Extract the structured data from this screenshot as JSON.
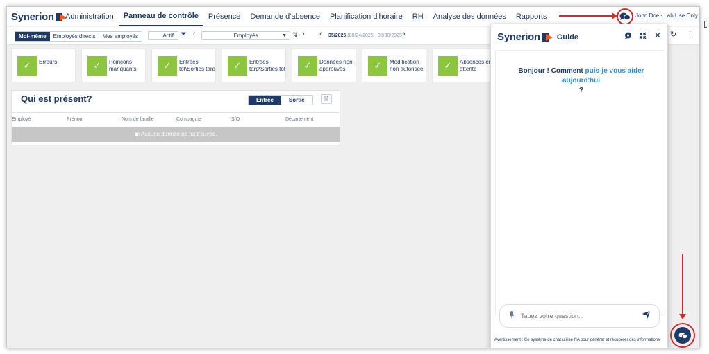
{
  "app": {
    "brand": "Synerion"
  },
  "nav": {
    "items": [
      "Administration",
      "Panneau de contrôle",
      "Présence",
      "Demande d'absence",
      "Planification d'horaire",
      "RH",
      "Analyse des données",
      "Rapports"
    ],
    "active": "Panneau de contrôle"
  },
  "user": {
    "name": "John Doe - Lab Use Only"
  },
  "toolbar": {
    "scope": [
      "Moi-même",
      "Employés directs",
      "Mes employés"
    ],
    "scope_active": "Moi-même",
    "status": "Actif",
    "group": "Employés",
    "period_week": "35/2025",
    "period_range": "(08/24/2025 - 08/30/2025)"
  },
  "cards": [
    {
      "label": "Erreurs"
    },
    {
      "label": "Poinçons manquants"
    },
    {
      "label": "Entrées tôt\\Sorties tard"
    },
    {
      "label": "Entrées tard\\Sorties tôt"
    },
    {
      "label": "Données non-approuvés"
    },
    {
      "label": "Modification non autorisée"
    },
    {
      "label": "Absences en attente"
    }
  ],
  "presence": {
    "title": "Qui est présent?",
    "toggle": [
      "Entrée",
      "Sortie"
    ],
    "toggle_active": "Entrée",
    "columns": [
      "Employé",
      "Prénom",
      "Nom de famille",
      "Compagnie",
      "S/O",
      "Département"
    ],
    "empty_text": "Aucune donnée ne fut trouvée."
  },
  "guide": {
    "brand": "Synerion",
    "label": "Guide",
    "greeting_start": "Bonjour ! Comment ",
    "greeting_highlight": "puis-je vous aider aujourd'hui",
    "greeting_end": "?",
    "input_placeholder": "Tapez votre question...",
    "disclaimer": "Avertissement : Ce système de chat utilise l'IA pour générer et récupérer des informations"
  },
  "colors": {
    "brand_navy": "#1e3a66",
    "brand_orange": "#f15a22",
    "success_green": "#8cc63f",
    "annotation_red": "#d42a2a"
  }
}
